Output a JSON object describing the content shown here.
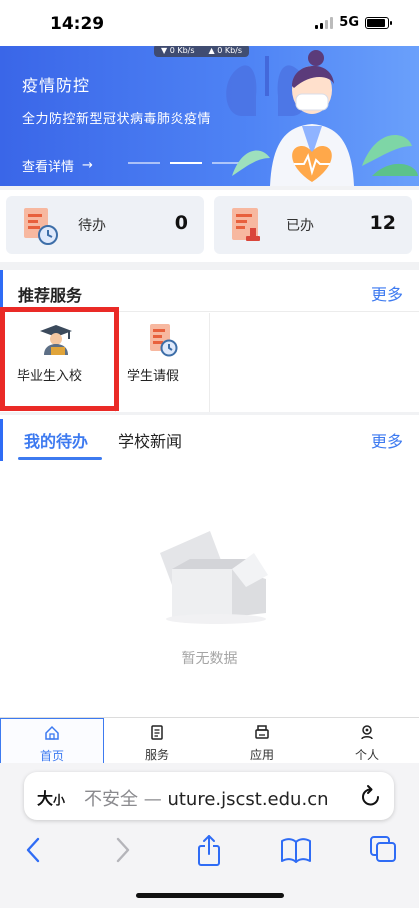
{
  "status": {
    "time": "14:29",
    "network": "5G",
    "battery_level": 0.9
  },
  "banner": {
    "net_down": "▼ 0 Kb/s",
    "net_up": "▲ 0 Kb/s",
    "title": "疫情防控",
    "subtitle": "全力防控新型冠状病毒肺炎疫情",
    "detail_link": "查看详情",
    "detail_arrow": "→",
    "slide_count": 3,
    "active_slide": 2
  },
  "stats": {
    "pending_label": "待办",
    "pending_value": "0",
    "done_label": "已办",
    "done_value": "12"
  },
  "recommended": {
    "title": "推荐服务",
    "more": "更多",
    "services": [
      {
        "label": "毕业生入校",
        "icon": "graduate-icon"
      },
      {
        "label": "学生请假",
        "icon": "document-clock-icon"
      }
    ]
  },
  "todo_section": {
    "tabs": [
      "我的待办",
      "学校新闻"
    ],
    "active_tab": 0,
    "more": "更多",
    "empty_text": "暂无数据"
  },
  "tabbar": {
    "items": [
      {
        "label": "首页",
        "icon": "home-icon"
      },
      {
        "label": "服务",
        "icon": "clipboard-icon"
      },
      {
        "label": "应用",
        "icon": "print-icon"
      },
      {
        "label": "个人",
        "icon": "user-pin-icon"
      }
    ],
    "active": 0
  },
  "browser": {
    "text_size_big": "大",
    "text_size_small": "小",
    "insecure_label": "不安全 — ",
    "url": "uture.jscst.edu.cn"
  },
  "colors": {
    "accent": "#3d7af0",
    "banner": "#4f84f5",
    "highlight": "#ea2a26"
  }
}
